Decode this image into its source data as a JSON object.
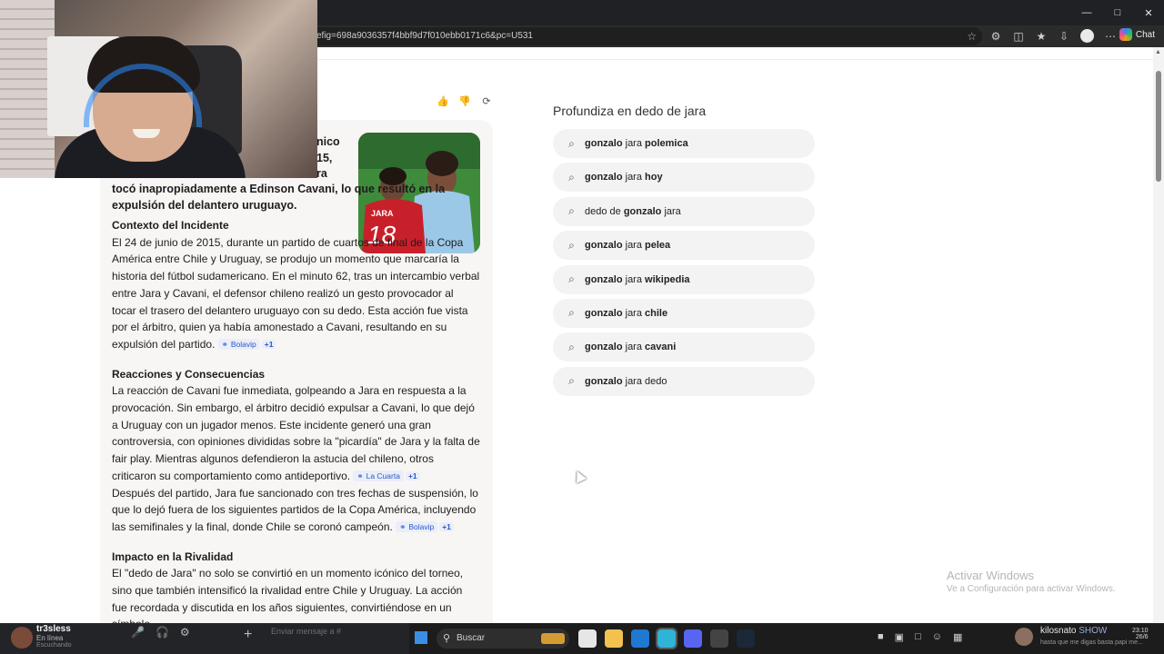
{
  "browser": {
    "url": "efig=698a9036357f4bbf9d7f010ebb0171c6&pc=U531",
    "chat_label": "Chat",
    "window_controls": [
      "minimize",
      "maximize",
      "close"
    ]
  },
  "answer": {
    "lead_fragments": [
      "nico",
      "15,",
      "ra"
    ],
    "lead_text": "tocó inapropiadamente a Edinson Cavani, lo que resultó en la expulsión del delantero uruguayo.",
    "sections": [
      {
        "heading": "Contexto del Incidente",
        "text": "El 24 de junio de 2015, durante un partido de cuartos de final de la Copa América entre Chile y Uruguay, se produjo un momento que marcaría la historia del fútbol sudamericano. En el minuto 62, tras un intercambio verbal entre Jara y Cavani, el defensor chileno realizó un gesto provocador al tocar el trasero del delantero uruguayo con su dedo. Esta acción fue vista por el árbitro, quien ya había amonestado a Cavani, resultando en su expulsión del partido.",
        "source": "Bolavip",
        "source_extra": "+1"
      },
      {
        "heading": "Reacciones y Consecuencias",
        "text": "La reacción de Cavani fue inmediata, golpeando a Jara en respuesta a la provocación. Sin embargo, el árbitro decidió expulsar a Cavani, lo que dejó a Uruguay con un jugador menos. Este incidente generó una gran controversia, con opiniones divididas sobre la \"picardía\" de Jara y la falta de fair play. Mientras algunos defendieron la astucia del chileno, otros criticaron su comportamiento como antideportivo.",
        "source": "La Cuarta",
        "source_extra": "+1",
        "text2": "Después del partido, Jara fue sancionado con tres fechas de suspensión, lo que lo dejó fuera de los siguientes partidos de la Copa América, incluyendo las semifinales y la final, donde Chile se coronó campeón.",
        "source2": "Bolavip",
        "source2_extra": "+1"
      },
      {
        "heading": "Impacto en la Rivalidad",
        "text": "El \"dedo de Jara\" no solo se convirtió en un momento icónico del torneo, sino que también intensificó la rivalidad entre Chile y Uruguay. La acción fue recordada y discutida en los años siguientes, convirtiéndose en un símbolo"
      }
    ],
    "photo_jersey_name": "JARA",
    "photo_jersey_number": "18"
  },
  "related": {
    "title": "Profundiza en dedo de jara",
    "items": [
      {
        "parts": [
          [
            "gonzalo",
            true
          ],
          [
            " jara ",
            false
          ],
          [
            "polemica",
            true
          ]
        ]
      },
      {
        "parts": [
          [
            "gonzalo",
            true
          ],
          [
            " jara ",
            false
          ],
          [
            "hoy",
            true
          ]
        ]
      },
      {
        "parts": [
          [
            "dedo de ",
            false
          ],
          [
            "gonzalo",
            true
          ],
          [
            " jara",
            false
          ]
        ]
      },
      {
        "parts": [
          [
            "gonzalo",
            true
          ],
          [
            " jara ",
            false
          ],
          [
            "pelea",
            true
          ]
        ]
      },
      {
        "parts": [
          [
            "gonzalo",
            true
          ],
          [
            " jara ",
            false
          ],
          [
            "wikipedia",
            true
          ]
        ]
      },
      {
        "parts": [
          [
            "gonzalo",
            true
          ],
          [
            " jara ",
            false
          ],
          [
            "chile",
            true
          ]
        ]
      },
      {
        "parts": [
          [
            "gonzalo",
            true
          ],
          [
            " jara ",
            false
          ],
          [
            "cavani",
            true
          ]
        ]
      },
      {
        "parts": [
          [
            "gonzalo",
            true
          ],
          [
            " jara ",
            false
          ],
          [
            "dedo",
            false
          ]
        ]
      }
    ]
  },
  "watermark": {
    "line1": "Activar Windows",
    "line2": "Ve a Configuración para activar Windows."
  },
  "discord": {
    "username": "tr3sless",
    "status": "En línea",
    "sub": "Escuchando",
    "input_placeholder": "Enviar mensaje a #"
  },
  "taskbar": {
    "search_placeholder": "Buscar",
    "user_name": "kilosnato",
    "user_badge": "SHOW",
    "user_message": "hasta que me digas basta papi me...",
    "clock_time": "23:10",
    "clock_date": "26/6"
  },
  "colors": {
    "accent_link": "#2a56c4",
    "card_bg": "#f8f6f4",
    "chip_bg": "#e9eef9"
  }
}
